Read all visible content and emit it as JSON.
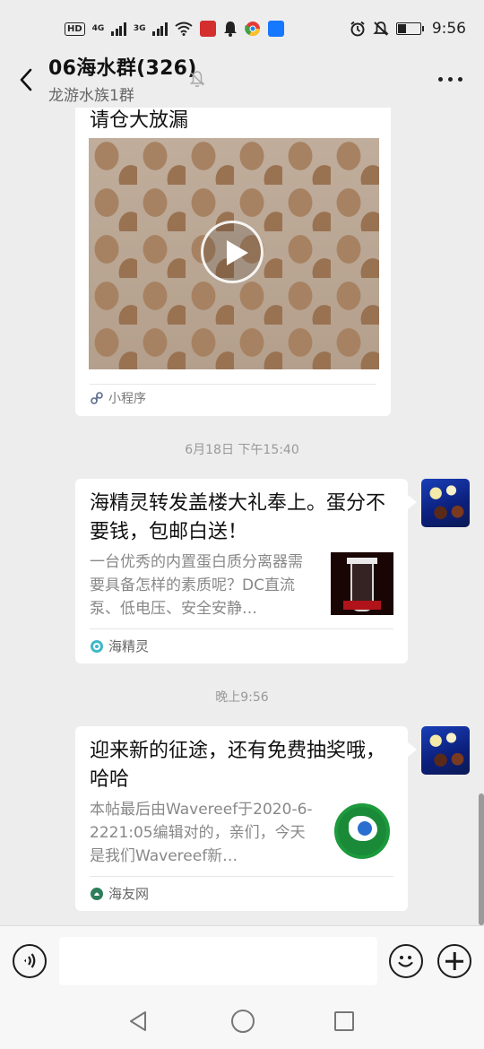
{
  "status_bar": {
    "network_badges": [
      "HD",
      "4G",
      "3G"
    ],
    "time": "9:56",
    "colors": {
      "red_app": "#d32f2f",
      "blue_app": "#1677ff"
    }
  },
  "header": {
    "title": "06海水群(326)",
    "subtitle": "龙游水族1群"
  },
  "messages": [
    {
      "type": "mini_program_card",
      "title": "请仓大放漏",
      "source": "小程序"
    },
    {
      "type": "timestamp",
      "text": "6月18日 下午15:40"
    },
    {
      "type": "link_card",
      "title": "海精灵转发盖楼大礼奉上。蛋分不要钱，包邮白送！",
      "description": "一台优秀的内置蛋白质分离器需要具备怎样的素质呢？DC直流泵、低电压、安全安静…",
      "source": "海精灵"
    },
    {
      "type": "timestamp",
      "text": "晚上9:56"
    },
    {
      "type": "link_card",
      "title": "迎来新的征途，还有免费抽奖哦，哈哈",
      "description": "本帖最后由Wavereef于2020-6-2221:05编辑对的，亲们，今天是我们Wavereef新…",
      "source": "海友网"
    }
  ],
  "input": {
    "value": "",
    "placeholder": ""
  }
}
